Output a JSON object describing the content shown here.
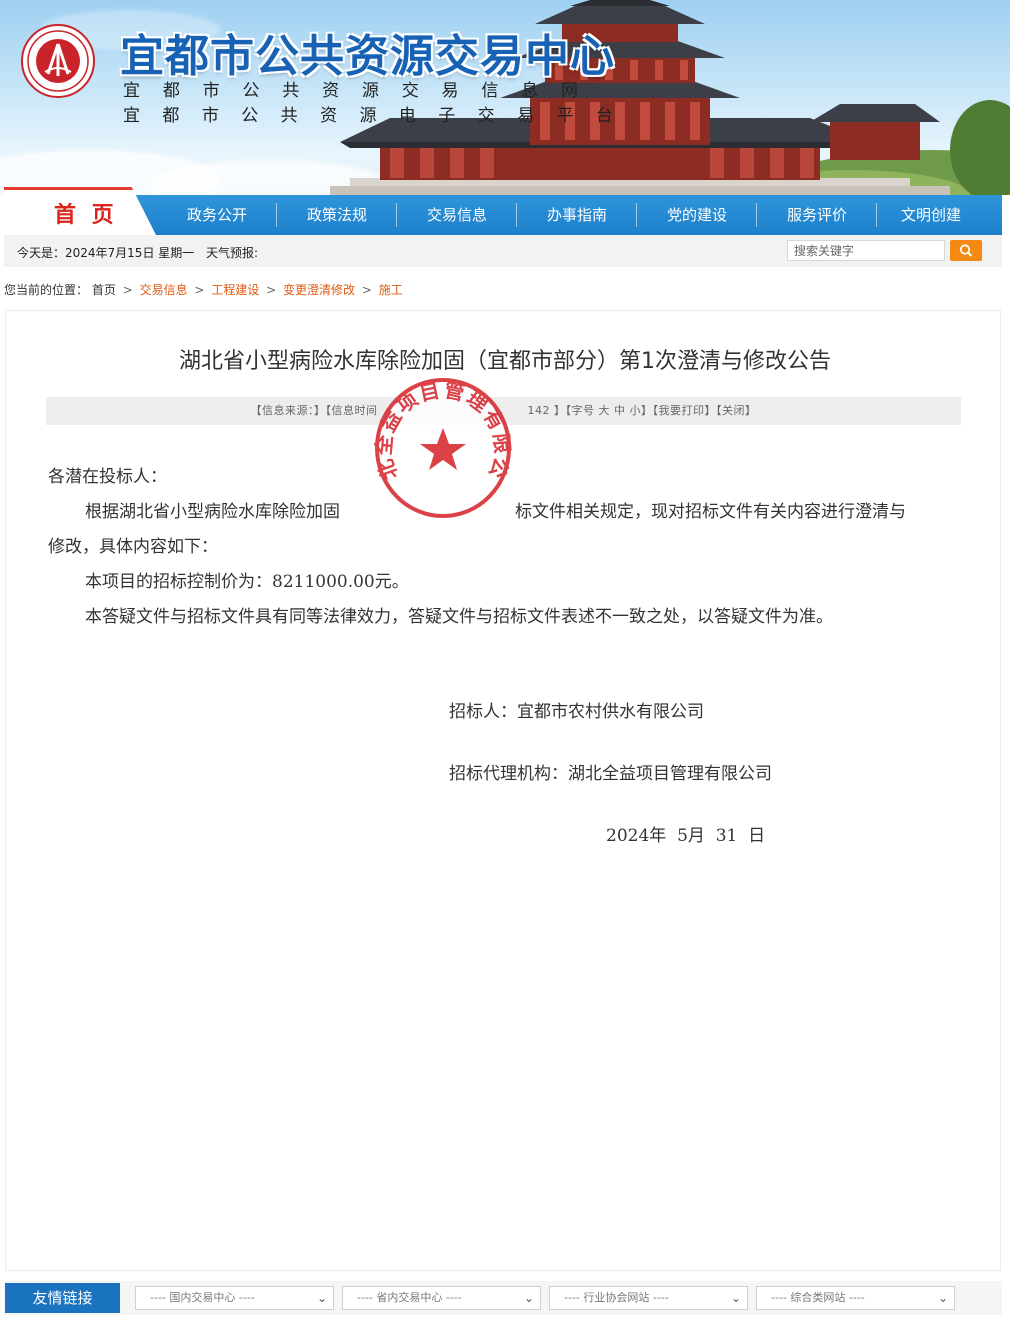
{
  "header": {
    "title": "宜都市公共资源交易中心",
    "subtitle1": [
      "宜",
      "都",
      "市",
      "公",
      "共",
      "资",
      "源",
      "交",
      "易",
      "信",
      "息",
      "网"
    ],
    "subtitle2": [
      "宜",
      "都",
      "市",
      "公",
      "共",
      "资",
      "源",
      "电",
      "子",
      "交",
      "易",
      "平",
      "台"
    ]
  },
  "nav": {
    "home": "首 页",
    "items": [
      "政务公开",
      "政策法规",
      "交易信息",
      "办事指南",
      "党的建设",
      "服务评价",
      "文明创建"
    ]
  },
  "info_bar": {
    "date": "今天是：2024年7月15日 星期一",
    "weather": "天气预报:",
    "search_placeholder": "搜索关键字"
  },
  "breadcrumb": {
    "prefix": "您当前的位置：",
    "home": "首页",
    "items": [
      "交易信息",
      "工程建设",
      "变更澄清修改",
      "施工"
    ],
    "separator": ">"
  },
  "article": {
    "title": "湖北省小型病险水库除险加固（宜都市部分）第1次澄清与修改公告",
    "meta_left": "【信息来源：】【信息时间",
    "meta_right": "142 】【字号 大 中 小】【我要打印】【关闭】",
    "salutation": "各潜在投标人：",
    "para1_a": "根据湖北省小型病险水库除险加固",
    "para1_b": "标文件相关规定，现对招标文件有关内容进行澄清与",
    "para1_c": "修改，具体内容如下：",
    "para2": "本项目的招标控制价为：8211000.00元。",
    "para3": "本答疑文件与招标文件具有同等法律效力，答疑文件与招标文件表述不一致之处，以答疑文件为准。",
    "tenderer": "招标人：宜都市农村供水有限公司",
    "agency": "招标代理机构：湖北全益项目管理有限公司",
    "date": "2024年  5月  31  日"
  },
  "seal": {
    "text": "湖北全益项目管理有限公司",
    "color": "#d7282f"
  },
  "footer": {
    "links_label": "友情链接",
    "selects": [
      "---- 国内交易中心 ----",
      "---- 省内交易中心 ----",
      "---- 行业协会网站 ----",
      "---- 综合类网站 ----"
    ]
  },
  "colors": {
    "nav_blue": "#1d7fcb",
    "accent_orange": "#e05a10",
    "search_orange": "#f48a12",
    "home_red": "#d8261c"
  }
}
